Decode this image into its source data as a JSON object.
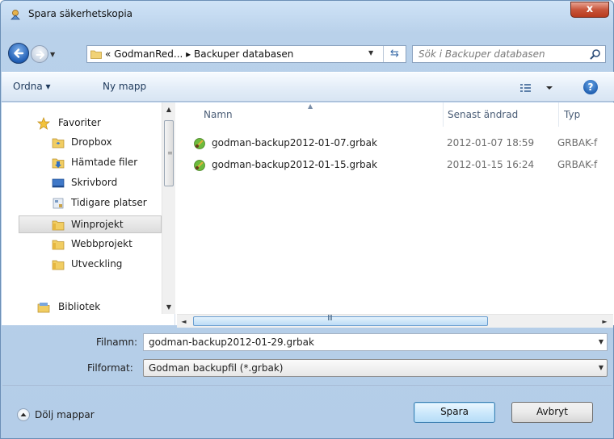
{
  "window": {
    "title": "Spara säkerhetskopia",
    "close_label": "x"
  },
  "address_bar": {
    "overflow": "«",
    "path": [
      "GodmanRed...",
      "Backuper databasen"
    ],
    "separator": "▸"
  },
  "search": {
    "placeholder": "Sök i Backuper databasen"
  },
  "toolbar": {
    "organize_label": "Ordna ▾",
    "new_folder_label": "Ny mapp",
    "help_label": "?"
  },
  "nav_pane": {
    "items": [
      {
        "label": "Favoriter",
        "icon": "star-icon"
      },
      {
        "label": "Dropbox",
        "icon": "dropbox-folder-icon"
      },
      {
        "label": "Hämtade filer",
        "icon": "downloads-folder-icon"
      },
      {
        "label": "Skrivbord",
        "icon": "desktop-icon"
      },
      {
        "label": "Tidigare platser",
        "icon": "recent-places-icon"
      },
      {
        "label": "Winprojekt",
        "icon": "folder-icon",
        "selected": true
      },
      {
        "label": "Webbprojekt",
        "icon": "folder-icon"
      },
      {
        "label": "Utveckling",
        "icon": "folder-icon"
      },
      {
        "label": "Bibliotek",
        "icon": "library-icon"
      }
    ]
  },
  "file_list": {
    "columns": [
      "Namn",
      "Senast ändrad",
      "Typ"
    ],
    "rows": [
      {
        "name": "godman-backup2012-01-07.grbak",
        "modified": "2012-01-07 18:59",
        "type": "GRBAK-f"
      },
      {
        "name": "godman-backup2012-01-15.grbak",
        "modified": "2012-01-15 16:24",
        "type": "GRBAK-f"
      }
    ]
  },
  "form": {
    "filename_label": "Filnamn:",
    "filename_value": "godman-backup2012-01-29.grbak",
    "format_label": "Filformat:",
    "format_value": "Godman backupfil (*.grbak)"
  },
  "footer": {
    "hide_folders_label": "Dölj mappar",
    "save_label": "Spara",
    "cancel_label": "Avbryt"
  },
  "colors": {
    "accent": "#3c7fb1",
    "title_close": "#c8553b"
  }
}
